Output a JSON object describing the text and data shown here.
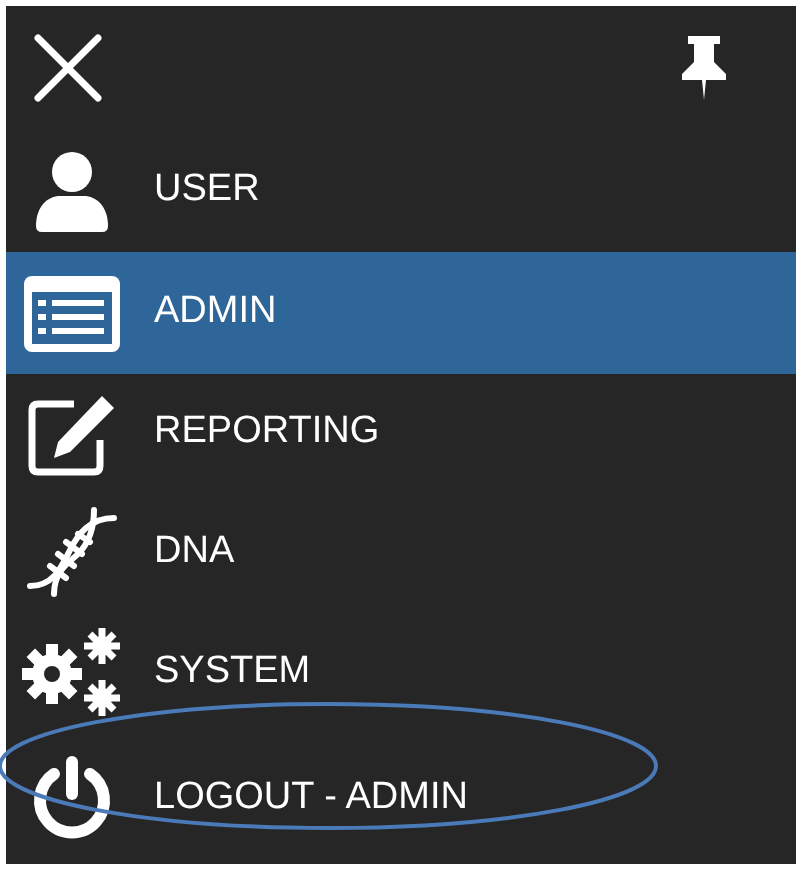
{
  "menu": [
    {
      "label": "USER",
      "kind": "user",
      "selected": false,
      "circled": false
    },
    {
      "label": "ADMIN",
      "kind": "list",
      "selected": true,
      "circled": false
    },
    {
      "label": "REPORTING",
      "kind": "edit",
      "selected": false,
      "circled": false
    },
    {
      "label": "DNA",
      "kind": "dna",
      "selected": false,
      "circled": false
    },
    {
      "label": "SYSTEM",
      "kind": "gears",
      "selected": false,
      "circled": false
    },
    {
      "label": "LOGOUT - ADMIN",
      "kind": "power",
      "selected": false,
      "circled": true
    }
  ]
}
